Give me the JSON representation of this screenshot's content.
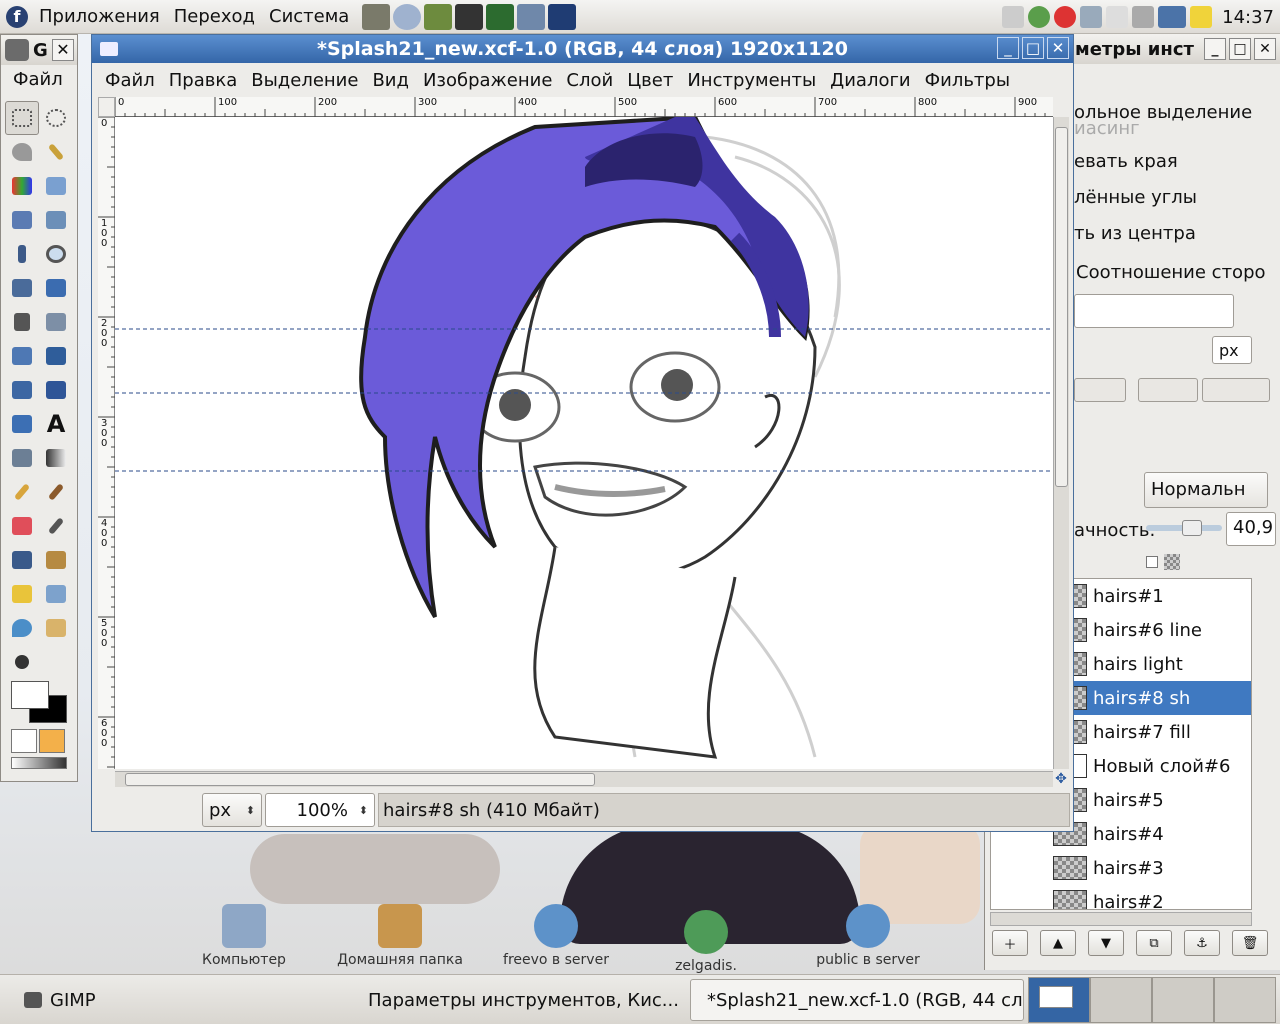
{
  "top_panel": {
    "menus": [
      "Приложения",
      "Переход",
      "Система"
    ],
    "clock": "14:37"
  },
  "toolbox": {
    "title": "G",
    "menu": "Файл"
  },
  "image_window": {
    "title": "*Splash21_new.xcf-1.0 (RGB, 44 слоя) 1920x1120",
    "menus": [
      "Файл",
      "Правка",
      "Выделение",
      "Вид",
      "Изображение",
      "Слой",
      "Цвет",
      "Инструменты",
      "Диалоги",
      "Фильтры"
    ],
    "ruler_top": [
      "0",
      "100",
      "200",
      "300",
      "400",
      "500",
      "600",
      "700",
      "800",
      "900"
    ],
    "ruler_left": [
      "0",
      "1\n0\n0",
      "2\n0\n0",
      "3\n0\n0",
      "4\n0\n0",
      "5\n0\n0",
      "6\n0\n0"
    ],
    "status": {
      "unit": "px",
      "zoom": "100%",
      "message": "hairs#8 sh (410 Мбайт)"
    }
  },
  "dock": {
    "title": "метры инст",
    "tool_options": {
      "option1": "ольное выделение",
      "option2": "иасинг",
      "option3": "евать края",
      "option4": "лённые углы",
      "option5": "ть из центра",
      "option6": "Соотношение сторо",
      "unit": "px"
    },
    "layers": {
      "mode": "Нормальн",
      "opacity_label": "ачность:",
      "opacity_value": "40,9",
      "items": [
        {
          "name": "hairs#1",
          "selected": false
        },
        {
          "name": "hairs#6 line",
          "selected": false
        },
        {
          "name": "hairs light",
          "selected": false
        },
        {
          "name": "hairs#8 sh",
          "selected": true
        },
        {
          "name": "hairs#7 fill",
          "selected": false
        },
        {
          "name": "Новый слой#6",
          "selected": false
        },
        {
          "name": "hairs#5",
          "selected": false
        },
        {
          "name": "hairs#4",
          "selected": false
        },
        {
          "name": "hairs#3",
          "selected": false
        },
        {
          "name": "hairs#2",
          "selected": false
        }
      ]
    }
  },
  "desktop_icons": [
    {
      "label": "Компьютер"
    },
    {
      "label": "Домашняя папка"
    },
    {
      "label": "freevo в server"
    },
    {
      "label": "zelgadis."
    },
    {
      "label": "public в server"
    }
  ],
  "taskbar": {
    "items": [
      {
        "label": "GIMP"
      },
      {
        "label": "Параметры инструментов, Кис..."
      },
      {
        "label": "*Splash21_new.xcf-1.0 (RGB, 44 сл..."
      }
    ]
  },
  "colors": {
    "titlebar": "#3466a8",
    "selection": "#3f79c1",
    "hair": "#6b5bd9",
    "hair_shadow": "#3f34a0"
  }
}
